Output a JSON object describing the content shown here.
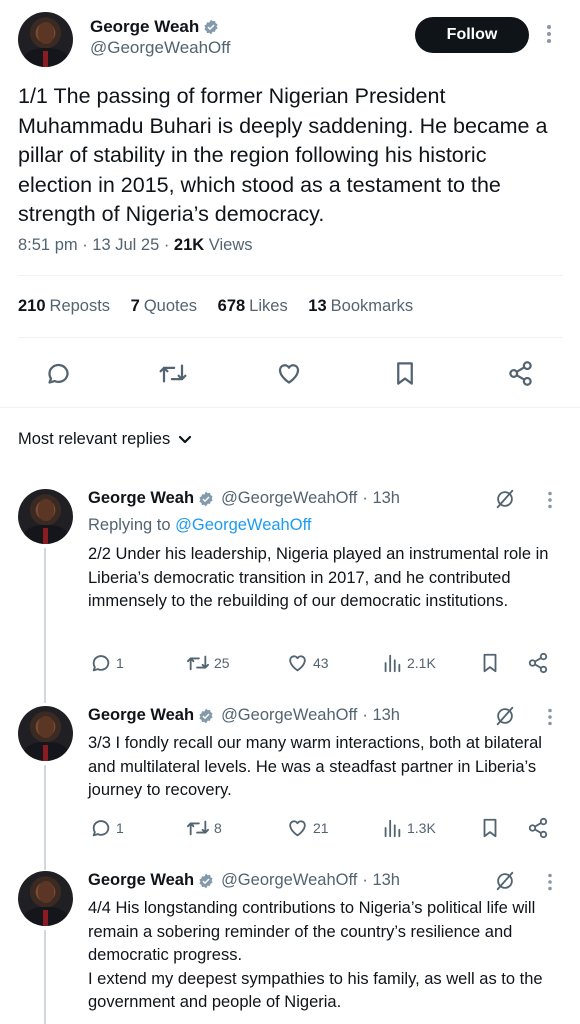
{
  "colors": {
    "text": "#0f1419",
    "muted": "#536471",
    "link": "#1d9bf0",
    "verified": "#829aab",
    "button": "#0f1419"
  },
  "main_tweet": {
    "author_name": "George Weah",
    "author_handle": "@GeorgeWeahOff",
    "follow_label": "Follow",
    "text": "1/1 The passing of former Nigerian President Muhammadu Buhari is deeply saddening. He became a pillar of stability in the region following his historic election in 2015, which stood as a testament to the strength of Nigeria’s democracy.",
    "timestamp": "8:51 pm · 13 Jul 25 · ",
    "views_count": "21K",
    "views_label": " Views",
    "stats": {
      "reposts_count": "210",
      "reposts_label": "Reposts",
      "quotes_count": "7",
      "quotes_label": "Quotes",
      "likes_count": "678",
      "likes_label": "Likes",
      "bookmarks_count": "13",
      "bookmarks_label": "Bookmarks"
    },
    "actions": [
      "reply-icon",
      "repost-icon",
      "like-icon",
      "bookmark-icon",
      "share-icon"
    ]
  },
  "replies_sort": {
    "label": "Most relevant replies",
    "icon": "chevron-down-icon"
  },
  "replies": [
    {
      "name": "George Weah",
      "handle": "@GeorgeWeahOff",
      "time": "· 13h",
      "replying_prefix": "Replying to ",
      "replying_handle": "@GeorgeWeahOff",
      "text": "2/2 Under his leadership, Nigeria played an instrumental role in Liberia’s democratic transition in 2017, and he contributed immensely to the rebuilding of our democratic institutions.",
      "reply_count": "1",
      "repost_count": "25",
      "like_count": "43",
      "view_count": "2.1K"
    },
    {
      "name": "George Weah",
      "handle": "@GeorgeWeahOff",
      "time": "· 13h",
      "text": "3/3 I fondly recall our many warm interactions, both at bilateral and multilateral levels. He was a steadfast partner in Liberia’s journey to recovery.",
      "reply_count": "1",
      "repost_count": "8",
      "like_count": "21",
      "view_count": "1.3K"
    },
    {
      "name": "George Weah",
      "handle": "@GeorgeWeahOff",
      "time": "· 13h",
      "text_line1": "4/4 His longstanding contributions to Nigeria’s political life will remain a sobering reminder of the country’s resilience and democratic progress.",
      "text_line2": "I extend my deepest sympathies to his family, as well as to the government and people of Nigeria."
    }
  ]
}
